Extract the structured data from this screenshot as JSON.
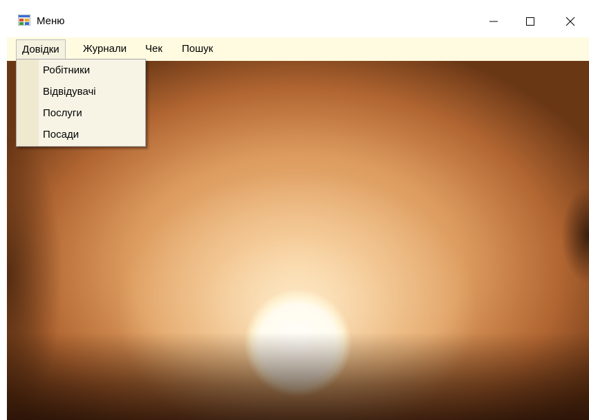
{
  "window": {
    "title": "Меню",
    "app_icon": "winforms-app-icon",
    "controls": {
      "minimize_icon": "minimize-icon",
      "maximize_icon": "maximize-icon",
      "close_icon": "close-icon"
    }
  },
  "menubar": {
    "items": [
      {
        "label": "Довідки",
        "open": true
      },
      {
        "label": "Журнали"
      },
      {
        "label": "Чек"
      },
      {
        "label": "Пошук"
      }
    ]
  },
  "dropdown": {
    "items": [
      {
        "label": "Робітники"
      },
      {
        "label": "Відвідувачі"
      },
      {
        "label": "Послуги"
      },
      {
        "label": "Посади"
      }
    ]
  },
  "background": {
    "image": "blurred-sunset-photo",
    "colors": {
      "sun": "#fffefa",
      "glow": "#f2c48f",
      "edge": "#4a2410"
    }
  },
  "colors": {
    "menubar_bg": "#fffbe0",
    "dropdown_bg": "#f7f4e6",
    "dropdown_gutter": "#efe9d0"
  }
}
